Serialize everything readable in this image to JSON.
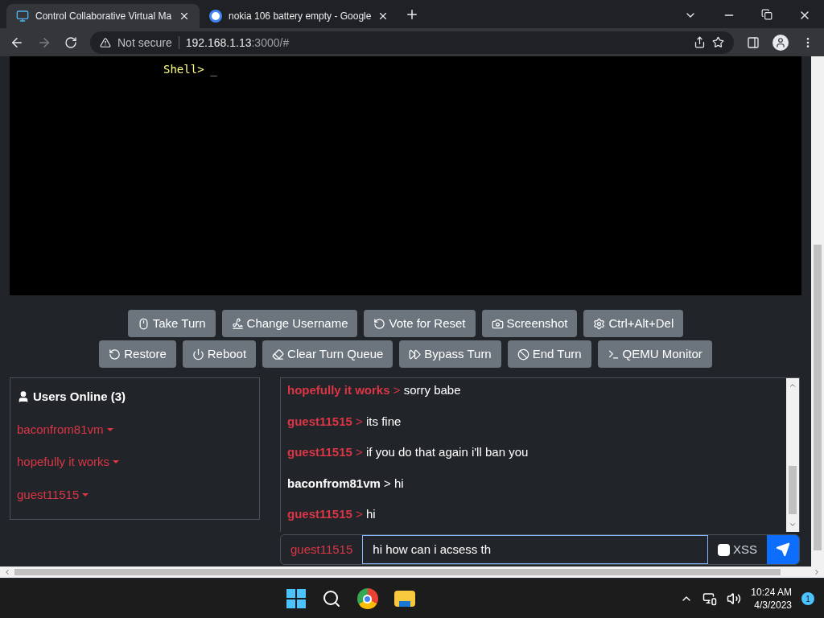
{
  "browser": {
    "tabs": [
      {
        "title": "Control Collaborative Virtual Ma",
        "selected": true,
        "kind": "monitor"
      },
      {
        "title": "nokia 106 battery empty - Google",
        "selected": false,
        "kind": "google"
      }
    ],
    "security": "Not secure",
    "url_host": "192.168.1.13",
    "url_rest": ":3000/#"
  },
  "vm_screen": {
    "prompt": "Shell>",
    "cursor": "_"
  },
  "buttons": [
    [
      {
        "label": "Take Turn"
      },
      {
        "label": "Change Username"
      },
      {
        "label": "Vote for Reset"
      },
      {
        "label": "Screenshot"
      },
      {
        "label": "Ctrl+Alt+Del"
      }
    ],
    [
      {
        "label": "Restore"
      },
      {
        "label": "Reboot"
      },
      {
        "label": "Clear Turn Queue"
      },
      {
        "label": "Bypass Turn"
      },
      {
        "label": "End Turn"
      },
      {
        "label": "QEMU Monitor"
      }
    ]
  ],
  "users": {
    "title": "Users Online (3)",
    "list": [
      "baconfrom81vm",
      "hopefully it works",
      "guest11515"
    ]
  },
  "chat": {
    "separator": ">",
    "messages": [
      {
        "user": "hopefully it works",
        "text": "sorry babe",
        "self": true
      },
      {
        "user": "guest11515",
        "text": "its fine",
        "self": true
      },
      {
        "user": "guest11515",
        "text": "if you do that again i'll ban you",
        "self": true
      },
      {
        "user": "baconfrom81vm",
        "text": "hi",
        "self": false
      },
      {
        "user": "guest11515",
        "text": "hi",
        "self": true
      }
    ],
    "username": "guest11515",
    "input": "hi how can i acsess th",
    "xss_label": "XSS",
    "xss_checked": false
  },
  "taskbar": {
    "time": "10:24 AM",
    "date": "4/3/2023",
    "notifications": "1"
  }
}
